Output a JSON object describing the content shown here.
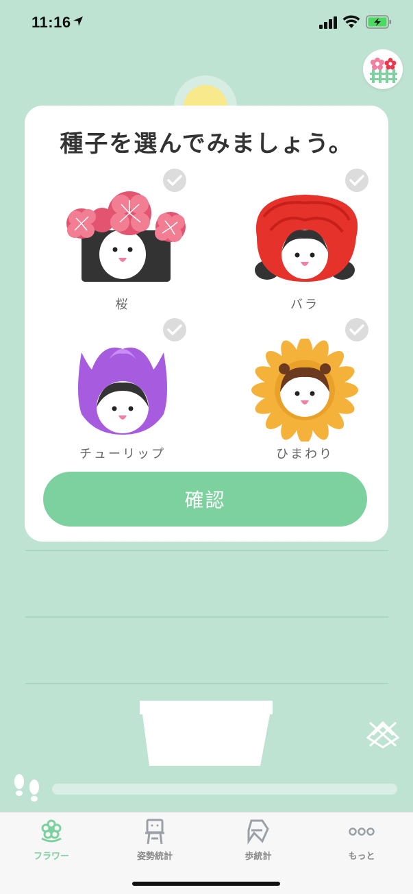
{
  "status": {
    "time": "11:16"
  },
  "colors": {
    "background": "#bfe3d3",
    "accent": "#7dd19e",
    "card": "#ffffff",
    "check": "#dcdcdc"
  },
  "card": {
    "title": "種子を選んでみましょう。",
    "seeds": [
      {
        "label": "桜",
        "icon": "sakura-flower-icon"
      },
      {
        "label": "バラ",
        "icon": "rose-flower-icon"
      },
      {
        "label": "チューリップ",
        "icon": "tulip-flower-icon"
      },
      {
        "label": "ひまわり",
        "icon": "sunflower-icon"
      }
    ],
    "confirm_label": "確認"
  },
  "tabs": [
    {
      "label": "フラワー",
      "icon": "flower-icon",
      "active": true
    },
    {
      "label": "姿勢統計",
      "icon": "posture-icon",
      "active": false
    },
    {
      "label": "歩統計",
      "icon": "walk-icon",
      "active": false
    },
    {
      "label": "もっと",
      "icon": "more-icon",
      "active": false
    }
  ]
}
